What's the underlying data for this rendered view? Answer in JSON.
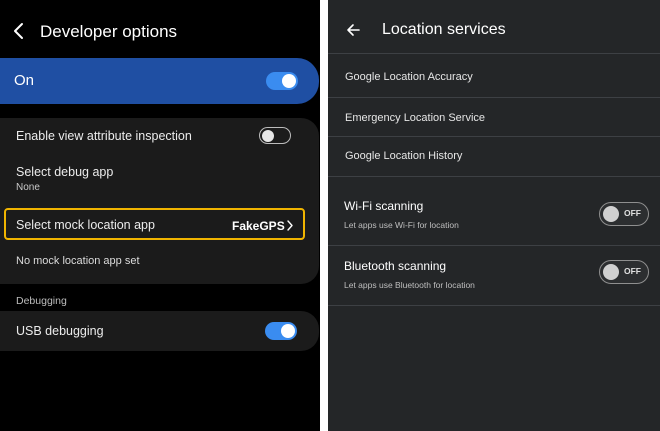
{
  "developer_options": {
    "title": "Developer options",
    "master": {
      "label": "On",
      "enabled": true
    },
    "view_attribute": {
      "label": "Enable view attribute inspection",
      "enabled": false
    },
    "debug_app": {
      "label": "Select debug app",
      "value": "None"
    },
    "mock_location": {
      "label": "Select mock location app",
      "value": "FakeGPS"
    },
    "mock_status": "No mock location app set",
    "section_debugging": "Debugging",
    "usb_debugging": {
      "label": "USB debugging",
      "enabled": true
    }
  },
  "location_services": {
    "title": "Location services",
    "items": [
      {
        "label": "Google Location Accuracy"
      },
      {
        "label": "Emergency Location Service"
      },
      {
        "label": "Google Location History"
      }
    ],
    "wifi_scanning": {
      "title": "Wi-Fi scanning",
      "subtitle": "Let apps use Wi-Fi for location",
      "state": "OFF"
    },
    "bluetooth_scanning": {
      "title": "Bluetooth scanning",
      "subtitle": "Let apps use Bluetooth for location",
      "state": "OFF"
    }
  },
  "colors": {
    "accent_blue": "#1f4fa3",
    "toggle_on": "#3a8cf0",
    "highlight_outline": "#f0b400"
  }
}
